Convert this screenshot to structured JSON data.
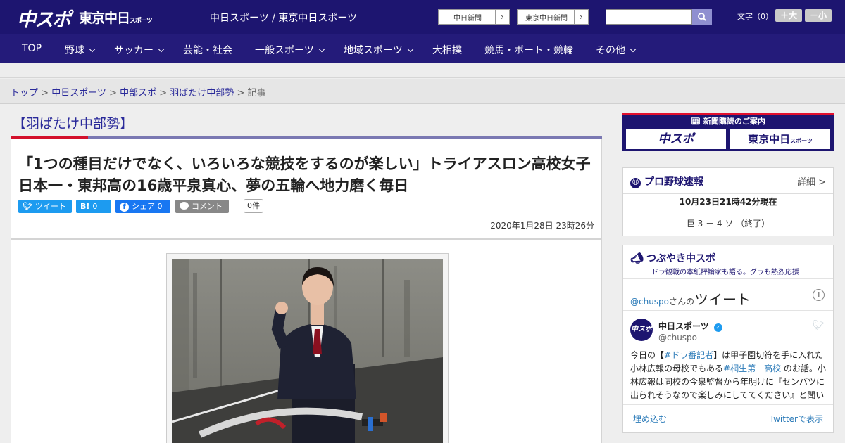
{
  "header": {
    "logo_chuspo": "中スポ",
    "logo_tokyo": "東京中日",
    "logo_tokyo_sub": "スポーツ",
    "sites_text": "中日スポーツ / 東京中日スポーツ",
    "site_buttons": [
      "中日新聞",
      "東京中日新聞"
    ],
    "search_placeholder": "",
    "fontsize_label": "文字（0）",
    "fontsize_plus": "＋大",
    "fontsize_minus": "－小"
  },
  "nav": {
    "items": [
      {
        "label": "TOP",
        "dropdown": false
      },
      {
        "label": "野球",
        "dropdown": true
      },
      {
        "label": "サッカー",
        "dropdown": true
      },
      {
        "label": "芸能・社会",
        "dropdown": false
      },
      {
        "label": "一般スポーツ",
        "dropdown": true
      },
      {
        "label": "地域スポーツ",
        "dropdown": true
      },
      {
        "label": "大相撲",
        "dropdown": false
      },
      {
        "label": "競馬・ボート・競輪",
        "dropdown": false
      },
      {
        "label": "その他",
        "dropdown": true
      }
    ]
  },
  "breadcrumb": {
    "items": [
      "トップ",
      "中日スポーツ",
      "中部スポ",
      "羽ばたけ中部勢"
    ],
    "separator": " > ",
    "current": "記事"
  },
  "article": {
    "section": "【羽ばたけ中部勢】",
    "headline": "「1つの種目だけでなく、いろいろな競技をするのが楽しい」トライアスロン高校女子日本一・東邦高の16歳平泉真心、夢の五輪へ地力磨く毎日",
    "share": {
      "tweet": "ツイート",
      "hatena_icon": "B!",
      "hatena_count": "0",
      "facebook": "シェア 0",
      "comment": "コメント",
      "comment_count": "0件"
    },
    "date": "2020年1月28日 23時26分"
  },
  "sidebar": {
    "subscribe_title": "新聞購読のご案内",
    "subscribe_logos": [
      "中スポ",
      "東京中日"
    ],
    "subscribe_logo_sub": "スポーツ",
    "baseball": {
      "title": "プロ野球速報",
      "detail": "詳細 >",
      "timestamp": "10月23日21時42分現在",
      "score": "巨 3 － 4 ソ （終了）"
    },
    "tsubuyaki": {
      "title": "つぶやき中スポ",
      "subtitle": "ドラ観戦の本紙評論家も語る。グラも熱烈応援",
      "tweets_handle": "@chuspo",
      "tweets_suffix": "さんの",
      "tweets_word": "ツイート",
      "account_name": "中日スポーツ",
      "account_handle": "@chuspo",
      "tweet_parts": [
        {
          "t": "今日の【",
          "link": false
        },
        {
          "t": "#ドラ番記者",
          "link": true
        },
        {
          "t": "】は甲子園切符を手に入れた小林広報の母校でもある",
          "link": false
        },
        {
          "t": "#桐生第一高校",
          "link": true
        },
        {
          "t": " のお話。小林広報は同校の今泉監督から年明けに『センバツに出られそうなので楽しみにしててください』と聞い",
          "link": false
        }
      ],
      "embed": "埋め込む",
      "view_on_twitter": "Twitterで表示"
    }
  },
  "colors": {
    "brand_navy": "#1d1570",
    "nav_bg": "#241b7a",
    "accent_red": "#d3102b",
    "link_blue": "#2a2a9a",
    "twitter_blue": "#1d9bf0",
    "facebook_blue": "#1877f2"
  },
  "icons": [
    "search-icon",
    "chevron-down-icon",
    "twitter-icon",
    "hatena-icon",
    "facebook-icon",
    "comment-icon",
    "baseball-icon",
    "megaphone-icon",
    "info-icon",
    "verified-icon",
    "twitter-bird-icon"
  ]
}
